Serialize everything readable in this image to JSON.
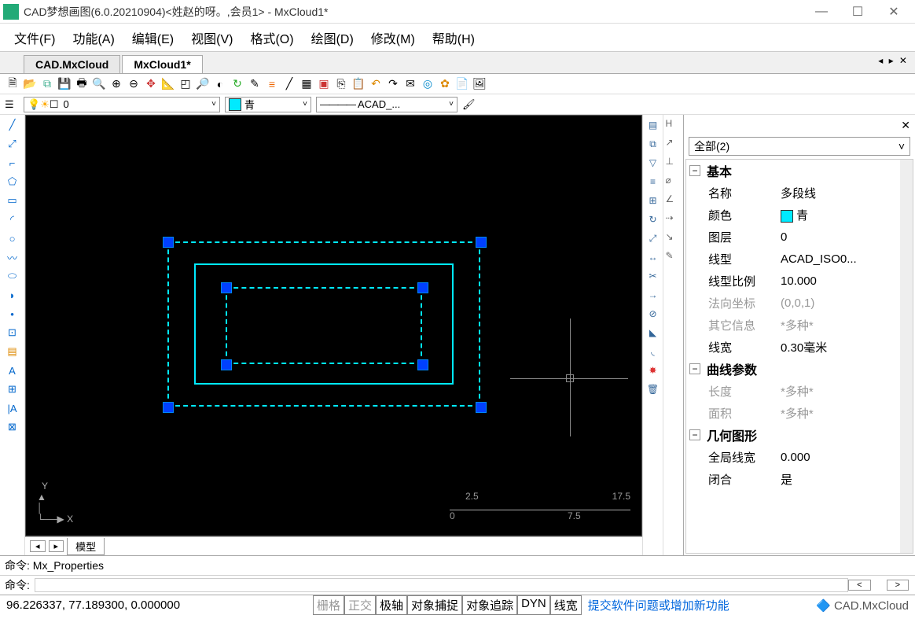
{
  "window": {
    "title": "CAD梦想画图(6.0.20210904)<姓赵的呀。,会员1> - MxCloud1*"
  },
  "menu": [
    "文件(F)",
    "功能(A)",
    "编辑(E)",
    "视图(V)",
    "格式(O)",
    "绘图(D)",
    "修改(M)",
    "帮助(H)"
  ],
  "tabs": {
    "inactive": "CAD.MxCloud",
    "active": "MxCloud1*"
  },
  "layerCombo": "0",
  "colorCombo": "青",
  "linetypeCombo": "ACAD_...",
  "linetypePrefix": "————",
  "scale": {
    "a": "2.5",
    "b": "17.5",
    "c": "0",
    "d": "7.5"
  },
  "ucs": {
    "x": "X",
    "y": "Y"
  },
  "props": {
    "filter": "全部(2)",
    "g1": "基本",
    "name_k": "名称",
    "name_v": "多段线",
    "color_k": "颜色",
    "color_v": "青",
    "layer_k": "图层",
    "layer_v": "0",
    "lt_k": "线型",
    "lt_v": "ACAD_ISO0...",
    "lts_k": "线型比例",
    "lts_v": "10.000",
    "norm_k": "法向坐标",
    "norm_v": "(0,0,1)",
    "misc_k": "其它信息",
    "misc_v": "*多种*",
    "lw_k": "线宽",
    "lw_v": "0.30毫米",
    "g2": "曲线参数",
    "len_k": "长度",
    "len_v": "*多种*",
    "area_k": "面积",
    "area_v": "*多种*",
    "g3": "几何图形",
    "glw_k": "全局线宽",
    "glw_v": "0.000",
    "closed_k": "闭合",
    "closed_v": "是"
  },
  "bottomTab": "模型",
  "cmd": {
    "hist": "命令: Mx_Properties",
    "label": "命令:"
  },
  "status": {
    "coords": "96.226337, 77.189300, 0.000000",
    "modes": [
      "栅格",
      "正交",
      "极轴",
      "对象捕捉",
      "对象追踪",
      "DYN",
      "线宽"
    ],
    "modesOff": [
      0,
      1
    ],
    "link": "提交软件问题或增加新功能",
    "brand": "CAD.MxCloud"
  }
}
